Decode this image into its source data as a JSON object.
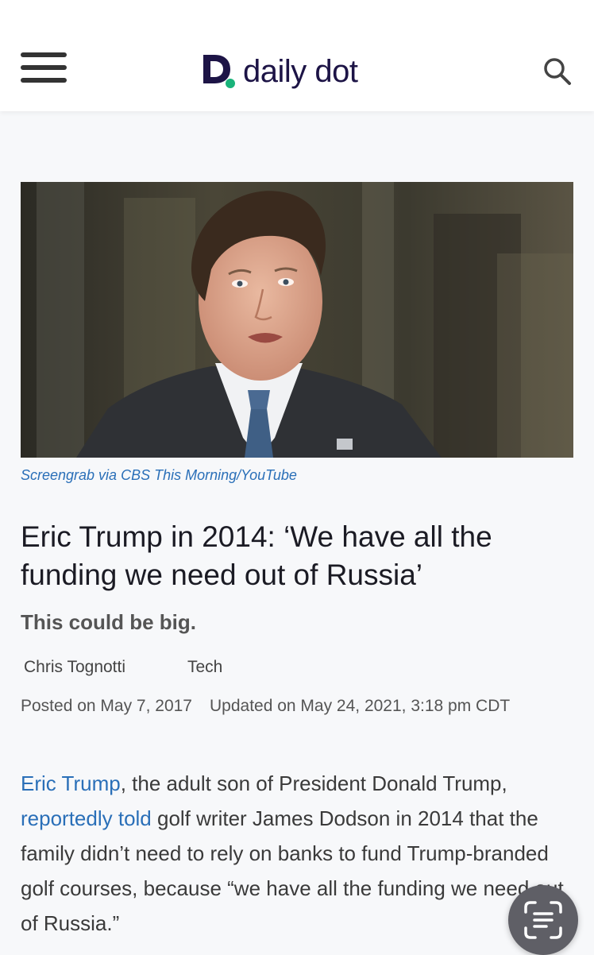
{
  "header": {
    "logo_text": "daily dot",
    "menu_icon": "hamburger-menu-icon",
    "search_icon": "search-icon"
  },
  "article": {
    "image_credit": "Screengrab via CBS This Morning/YouTube",
    "title": "Eric Trump in 2014: ‘We have all the funding we need out of Russia’",
    "dek": "This could be big.",
    "author": "Chris Tognotti",
    "category": "Tech",
    "posted": "Posted on May 7, 2017",
    "updated": "Updated on May 24, 2021, 3:18 pm CDT",
    "body": {
      "link1": "Eric Trump",
      "text1": ", the adult son of President Donald Trump, ",
      "link2": "reportedly told",
      "text2": " golf writer James Dodson in 2014 that the family didn’t need to rely on banks to fund Trump-branded golf courses, because “we have all the funding we need out of Russia.”"
    }
  },
  "floating_button": {
    "icon": "text-scan-icon"
  },
  "colors": {
    "brand_navy": "#1d1446",
    "brand_green": "#19b37a",
    "link_blue": "#2a6fb8"
  }
}
